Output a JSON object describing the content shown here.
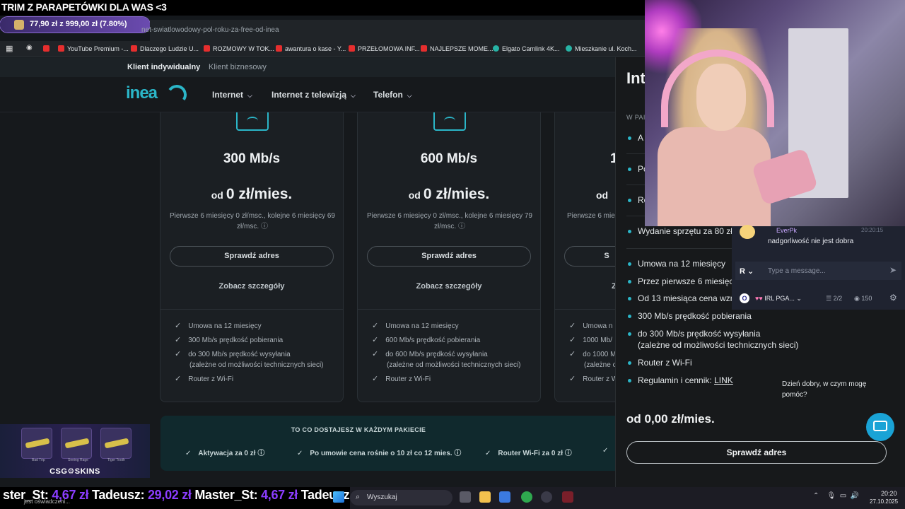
{
  "stream": {
    "banner": "TRIM Z PARAPETÓWKI DLA WAS <3",
    "goal": "77,90 zł z 999,00 zł (7.80%)",
    "ticker": [
      {
        "name": "ster_St:",
        "amount": "4,67 zł"
      },
      {
        "name": "Tadeusz:",
        "amount": "29,02 zł"
      },
      {
        "name": "Master_St:",
        "amount": "4,67 zł"
      },
      {
        "name": "Tadeusz:",
        "amount": ""
      }
    ],
    "ticker_small": "jest oświadczeni...",
    "ad_brand": "CSG⚙SKINS",
    "ad_skins": [
      "Bad Trip",
      "Seeing Rage",
      "Tiger Tooth"
    ]
  },
  "browser": {
    "url": "net-swiatlowodowy-pol-roku-za-free-od-inea",
    "bookmarks": [
      "YouTube Premium -...",
      "Dlaczego Ludzie U...",
      "ROZMOWY W TOK...",
      "awantura o kase - Y...",
      "PRZEŁOMOWA INF...",
      "NAJLEPSZE MOME...",
      "Elgato Camlink 4K...",
      "Mieszkanie ul. Koch..."
    ]
  },
  "site": {
    "segments": [
      "Klient indywidualny",
      "Klient biznesowy"
    ],
    "logo": "inea",
    "nav": [
      "Internet",
      "Internet z telewizją",
      "Telefon"
    ],
    "plans": [
      {
        "speed": "300 Mb/s",
        "price_prefix": "od",
        "price": "0 zł/mies.",
        "desc": "Pierwsze 6 miesięcy 0 zł/msc., kolejne 6 miesięcy 69 zł/msc.",
        "cta": "Sprawdź adres",
        "details": "Zobacz szczegóły",
        "features": [
          "Umowa na 12 miesięcy",
          "300 Mb/s prędkość pobierania",
          "do 300 Mb/s prędkość wysyłania",
          "(zależne od możliwości technicznych sieci)",
          "Router z Wi-Fi"
        ]
      },
      {
        "speed": "600 Mb/s",
        "price_prefix": "od",
        "price": "0 zł/mies.",
        "desc": "Pierwsze 6 miesięcy 0 zł/msc., kolejne 6 miesięcy 79 zł/msc.",
        "cta": "Sprawdź adres",
        "details": "Zobacz szczegóły",
        "features": [
          "Umowa na 12 miesięcy",
          "600 Mb/s prędkość pobierania",
          "do 600 Mb/s prędkość wysyłania",
          "(zależne od możliwości technicznych sieci)",
          "Router z Wi-Fi"
        ]
      },
      {
        "speed": "1",
        "price_prefix": "od",
        "price": "",
        "desc": "Pierwsze 6 mies",
        "cta": "S",
        "details": "Z",
        "features": [
          "Umowa n",
          "1000 Mb/",
          "do 1000 M",
          "(zależne o",
          "Router z W"
        ]
      }
    ],
    "band": {
      "title": "TO CO DOSTAJESZ W KAŻDYM PAKIECIE",
      "items": [
        "Aktywacja za 0 zł",
        "Po umowie cena rośnie o 10 zł co 12 mies.",
        "Router Wi-Fi za 0 zł"
      ]
    }
  },
  "panel": {
    "title": "Int",
    "subtitle": "W PAI",
    "top_items": [
      "A",
      "Po",
      "Ro",
      "Wydanie sprzętu za 80 zł"
    ],
    "items": [
      "Umowa na 12 miesięcy",
      "Przez pierwsze 6 miesięcy",
      "Od 13 miesiąca cena wzro",
      "300 Mb/s prędkość pobierania",
      "do 300 Mb/s prędkość wysyłania",
      "(zależne od możliwości technicznych sieci)",
      "Router z Wi-Fi"
    ],
    "terms_label": "Regulamin i cennik:",
    "terms_link": "LINK",
    "total": "od 0,00 zł/mies.",
    "cta": "Sprawdź adres",
    "help": "Dzień dobry, w czym mogę pomóc?"
  },
  "chat": {
    "user": "EverPk",
    "time": "20:20:15",
    "message": "nadgorliwość nie jest dobra",
    "placeholder": "Type a message...",
    "channel": "IRL PGA...",
    "stat_slots": "2/2",
    "viewers": "150"
  },
  "taskbar": {
    "search": "Wyszukaj",
    "time": "20:20",
    "date": "27.10.2025"
  }
}
